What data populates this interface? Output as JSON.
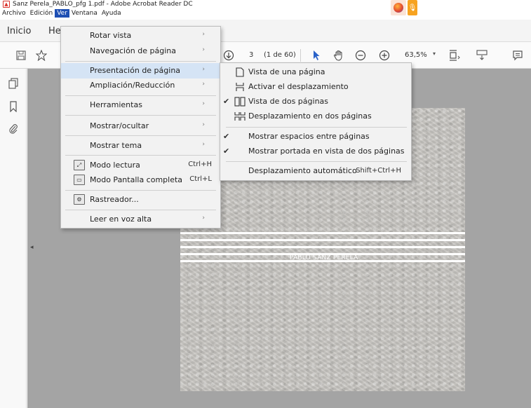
{
  "window": {
    "title": "Sanz Perela_PABLO_pfg 1.pdf - Adobe Acrobat Reader DC",
    "pdf_icon": "acrobat-pdf-icon",
    "taskbar": [
      "firefox-icon",
      "microphone-icon"
    ]
  },
  "menubar": {
    "items": [
      "Archivo",
      "Edición",
      "Ver",
      "Ventana",
      "Ayuda"
    ],
    "active": "Ver"
  },
  "tabs": {
    "inicio": "Inicio",
    "herramientas_partial": "He"
  },
  "toolbar": {
    "current_page": "3",
    "page_total": "(1 de 60)",
    "zoom": "63,5%",
    "zoom_caret": "▾"
  },
  "sidebar": {
    "icons": [
      "pages-icon",
      "bookmark-icon",
      "attachment-icon"
    ],
    "collapse": "◂"
  },
  "ver_menu": {
    "items": [
      {
        "label": "Rotar vista",
        "arrow": "›"
      },
      {
        "label": "Navegación de página",
        "arrow": "›"
      },
      {
        "label": "Presentación de página",
        "arrow": "›"
      },
      {
        "label": "Ampliación/Reducción",
        "arrow": "›"
      },
      {
        "label": "Herramientas",
        "arrow": "›"
      },
      {
        "label": "Mostrar/ocultar",
        "arrow": "›"
      },
      {
        "label": "Mostrar tema",
        "arrow": "›"
      },
      {
        "label": "Modo lectura",
        "shortcut": "Ctrl+H"
      },
      {
        "label": "Modo Pantalla completa",
        "shortcut": "Ctrl+L"
      },
      {
        "label": "Rastreador..."
      },
      {
        "label": "Leer en voz alta",
        "arrow": "›"
      }
    ]
  },
  "presentacion_submenu": {
    "items": [
      {
        "label": "Vista de una página",
        "check": ""
      },
      {
        "label": "Activar el desplazamiento",
        "check": ""
      },
      {
        "label": "Vista de dos páginas",
        "check": "✔"
      },
      {
        "label": "Desplazamiento en dos páginas",
        "check": ""
      },
      {
        "label": "Mostrar espacios entre páginas",
        "check": "✔"
      },
      {
        "label": "Mostrar portada en vista de dos páginas",
        "check": "✔"
      },
      {
        "label": "Desplazamiento automático",
        "shortcut": "Shift+Ctrl+H"
      }
    ]
  },
  "document": {
    "cover_name": "PABLO SANZ PERELA"
  },
  "colors": {
    "menu_active": "#1e4fb3",
    "highlight": "#d5e4f5",
    "doc_bg": "#a4a4a4"
  }
}
